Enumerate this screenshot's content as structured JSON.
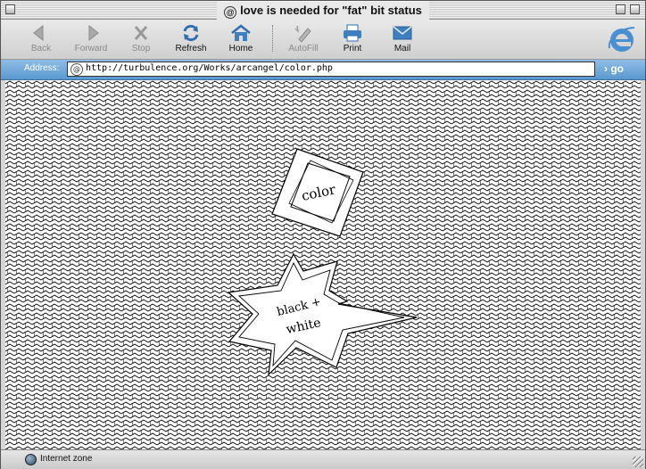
{
  "window": {
    "title_glyph": "@",
    "title": "love is needed for \"fat\" bit status"
  },
  "toolbar": {
    "buttons": [
      {
        "label": "Back",
        "icon": "back-arrow-icon",
        "enabled": false
      },
      {
        "label": "Forward",
        "icon": "forward-arrow-icon",
        "enabled": false
      },
      {
        "label": "Stop",
        "icon": "stop-icon",
        "enabled": false
      },
      {
        "label": "Refresh",
        "icon": "refresh-icon",
        "enabled": true
      },
      {
        "label": "Home",
        "icon": "home-icon",
        "enabled": true
      },
      {
        "label": "AutoFill",
        "icon": "autofill-icon",
        "enabled": false
      },
      {
        "label": "Print",
        "icon": "printer-icon",
        "enabled": true
      },
      {
        "label": "Mail",
        "icon": "mail-icon",
        "enabled": true
      }
    ]
  },
  "address": {
    "label": "Address:",
    "url": "http://turbulence.org/Works/arcangel/color.php",
    "go_label": "go"
  },
  "content": {
    "pattern_color": "#000000",
    "background": "#ffffff",
    "links": [
      {
        "text": "color"
      },
      {
        "text_line1": "black +",
        "text_line2": "white"
      }
    ]
  },
  "status": {
    "zone": "Internet zone"
  },
  "colors": {
    "address_bar": "#6aa6d9",
    "accent_blue": "#3f7fc0"
  }
}
